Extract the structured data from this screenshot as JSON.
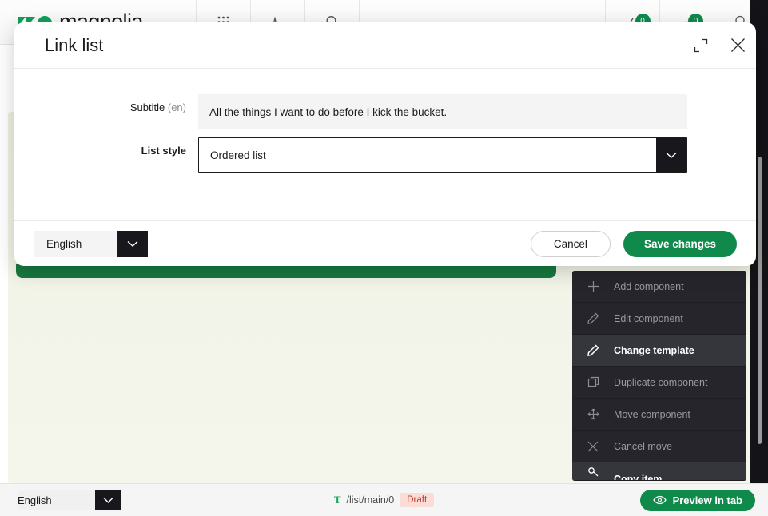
{
  "app": {
    "brand_name": "magnolia",
    "toolbar_icons": [
      "apps-grid-icon",
      "pulse-icon",
      "search-circle-icon",
      "tasks-icon",
      "notifications-icon",
      "search-icon"
    ],
    "badge_tasks": "0",
    "badge_notifications": "0"
  },
  "dialog": {
    "title": "Link list",
    "expand_icon": "expand-icon",
    "close_icon": "close-icon",
    "fields": {
      "subtitle": {
        "label": "Subtitle",
        "locale_suffix": "(en)",
        "value": "All the things I want to do before I kick the bucket."
      },
      "list_style": {
        "label": "List style",
        "value": "Ordered list",
        "chevron": "chevron-down-icon"
      }
    },
    "footer": {
      "language": "English",
      "language_chevron": "chevron-down-icon",
      "cancel_label": "Cancel",
      "save_label": "Save changes"
    }
  },
  "context_menu": {
    "items": [
      {
        "label": "Add component",
        "icon": "plus-icon",
        "active": false
      },
      {
        "label": "Edit component",
        "icon": "pencil-icon",
        "active": false
      },
      {
        "label": "Change template",
        "icon": "pencil-icon",
        "active": true
      },
      {
        "label": "Duplicate component",
        "icon": "duplicate-icon",
        "active": false
      },
      {
        "label": "Move component",
        "icon": "move-icon",
        "active": false
      },
      {
        "label": "Cancel move",
        "icon": "close-icon",
        "active": false
      },
      {
        "label": "Copy item",
        "icon": "copy-icon",
        "active": true
      }
    ]
  },
  "statusbar": {
    "language": "English",
    "language_chevron": "chevron-down-icon",
    "template_icon": "template-t-icon",
    "path": "/list/main/0",
    "status_badge": "Draft",
    "preview_label": "Preview in tab",
    "preview_icon": "eye-icon"
  },
  "colors": {
    "brand_green": "#0f8a4a",
    "canvas_green_bar": "#17793f",
    "draft_badge_bg": "#fbdcd6",
    "draft_badge_text": "#c0392b",
    "dark_panel": "#131318",
    "menu_bg": "#25252b",
    "menu_active_bg": "#35353c"
  }
}
